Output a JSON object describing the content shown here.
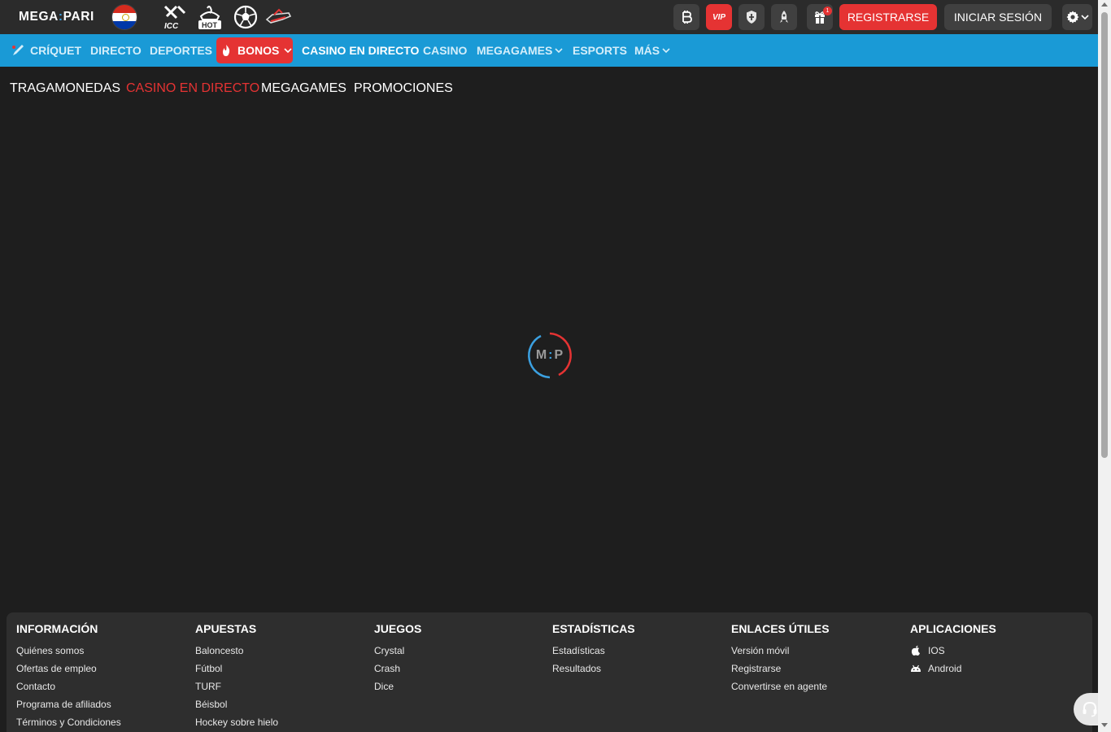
{
  "header": {
    "logo": {
      "left": "MEGA",
      "sep": ":",
      "right": "PARI"
    },
    "flag_icon": "paraguay-flag-icon",
    "promo_icons": [
      "icc-icon",
      "hot-icon",
      "football-icon",
      "aviator-icon"
    ],
    "icon_buttons": [
      {
        "name": "bitcoin-icon"
      },
      {
        "name": "vip-icon",
        "label": "VIP"
      },
      {
        "name": "shield-icon"
      },
      {
        "name": "rocket-icon"
      },
      {
        "name": "gift-icon",
        "badge": "1"
      }
    ],
    "register_label": "REGISTRARSE",
    "login_label": "INICIAR SESIÓN",
    "settings_icon": "gear-icon"
  },
  "main_nav": {
    "items": [
      {
        "label": "CRÍQUET"
      },
      {
        "label": "DIRECTO"
      },
      {
        "label": "DEPORTES"
      },
      {
        "label": "BONOS"
      },
      {
        "label": "CASINO EN DIRECTO",
        "active": true
      },
      {
        "label": "CASINO"
      },
      {
        "label": "MEGAGAMES"
      },
      {
        "label": "ESPORTS"
      },
      {
        "label": "MÁS"
      }
    ]
  },
  "sub_nav": {
    "items": [
      {
        "label": "TRAGAMONEDAS"
      },
      {
        "label": "CASINO EN DIRECTO",
        "active": true
      },
      {
        "label": "MEGAGAMES"
      },
      {
        "label": "PROMOCIONES"
      }
    ]
  },
  "loader": {
    "left": "M",
    "sep": ":",
    "right": "P"
  },
  "footer": {
    "columns": [
      {
        "title": "INFORMACIÓN",
        "links": [
          "Quiénes somos",
          "Ofertas de empleo",
          "Contacto",
          "Programa de afiliados",
          "Términos y Condiciones"
        ]
      },
      {
        "title": "APUESTAS",
        "links": [
          "Baloncesto",
          "Fútbol",
          "TURF",
          "Béisbol",
          "Hockey sobre hielo"
        ]
      },
      {
        "title": "JUEGOS",
        "links": [
          "Crystal",
          "Crash",
          "Dice"
        ]
      },
      {
        "title": "ESTADÍSTICAS",
        "links": [
          "Estadísticas",
          "Resultados"
        ]
      },
      {
        "title": "ENLACES ÚTILES",
        "links": [
          "Versión móvil",
          "Registrarse",
          "Convertirse en agente"
        ]
      },
      {
        "title": "APLICACIONES",
        "links": [
          "IOS",
          "Android"
        ]
      }
    ]
  },
  "colors": {
    "accent_red": "#e53333",
    "nav_blue": "#1a9ad6",
    "background": "#1e1e1e"
  }
}
